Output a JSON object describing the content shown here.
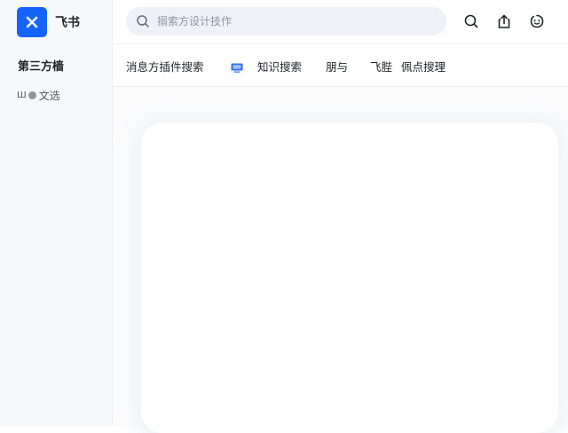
{
  "app": {
    "name": "飞书"
  },
  "sidebar": {
    "title": "第三方樯",
    "item": {
      "prefix": "Ш",
      "label": "文选"
    }
  },
  "search": {
    "placeholder": "搦索方设计技作",
    "value": ""
  },
  "toolbar": {
    "icons": [
      "search-icon",
      "share-icon",
      "assistant-icon"
    ]
  },
  "tabs": [
    {
      "label": "消息方插件搜索"
    },
    {
      "label": "知识搜索",
      "icon": "monitor-icon"
    },
    {
      "label": "朋与"
    },
    {
      "label": "飞䏶"
    },
    {
      "label": "佩点搜理"
    }
  ],
  "colors": {
    "accent": "#1664ff",
    "sidebar_bg": "#f7f8fa",
    "search_bg": "#eef1f7"
  }
}
